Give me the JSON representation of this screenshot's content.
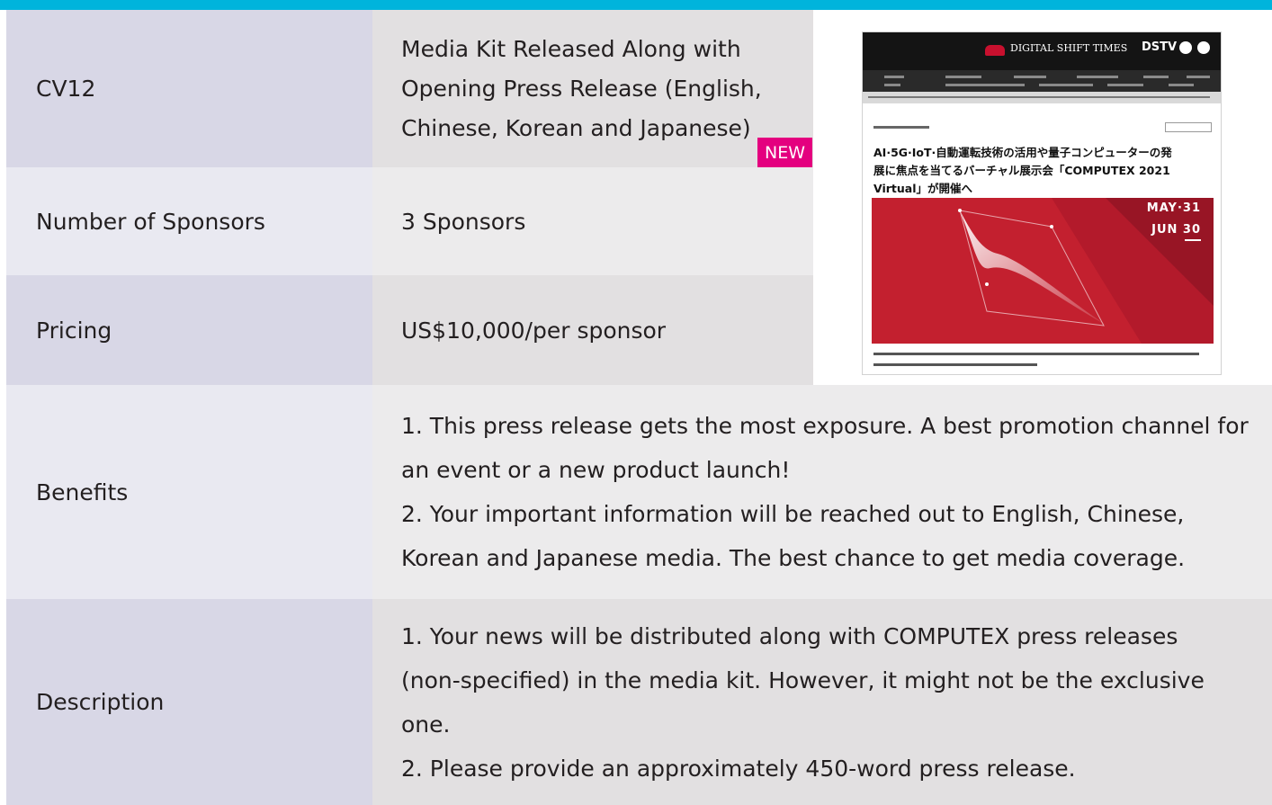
{
  "colors": {
    "top_bar": "#00b4dc",
    "label_dark": "#d8d7e6",
    "label_light": "#e9e9f1",
    "value_dark": "#e2e0e1",
    "value_light": "#ecebec",
    "new_badge": "#e4007f"
  },
  "rows": {
    "item": {
      "label": "CV12",
      "value_lines": [
        "Media Kit Released Along with",
        "Opening Press Release (English,",
        "Chinese, Korean and Japanese)"
      ],
      "badge": "NEW"
    },
    "sponsors": {
      "label": "Number of Sponsors",
      "value": "3 Sponsors"
    },
    "pricing": {
      "label": "Pricing",
      "value": "US$10,000/per sponsor"
    },
    "benefits": {
      "label": "Benefits",
      "lines": [
        "1. This press release gets the most exposure. A  best promotion channel for",
        "an event or a new product launch!",
        "2. Your important information will be reached out to English, Chinese,",
        "Korean and Japanese media. The best chance to get media coverage."
      ]
    },
    "description": {
      "label": "Description",
      "lines": [
        "1. Your news will be distributed along with COMPUTEX press releases",
        "(non-specified) in the media kit. However, it  might not be the exclusive",
        "one.",
        "2. Please provide an approximately 450-word press release."
      ]
    }
  },
  "preview": {
    "site_name": "DIGITAL SHIFT TIMES",
    "site_badge": "DSTV",
    "headline_lines": [
      "AI·5G·IoT·自動運転技術の活用や量子コンピューターの発",
      "展に焦点を当てるバーチャル展示会「COMPUTEX 2021",
      "Virtual」が開催へ"
    ],
    "hero_date_1": "MAY·31",
    "hero_date_2": "JUN 30",
    "icons": [
      "facebook-icon",
      "twitter-icon",
      "site-logo-icon"
    ]
  }
}
